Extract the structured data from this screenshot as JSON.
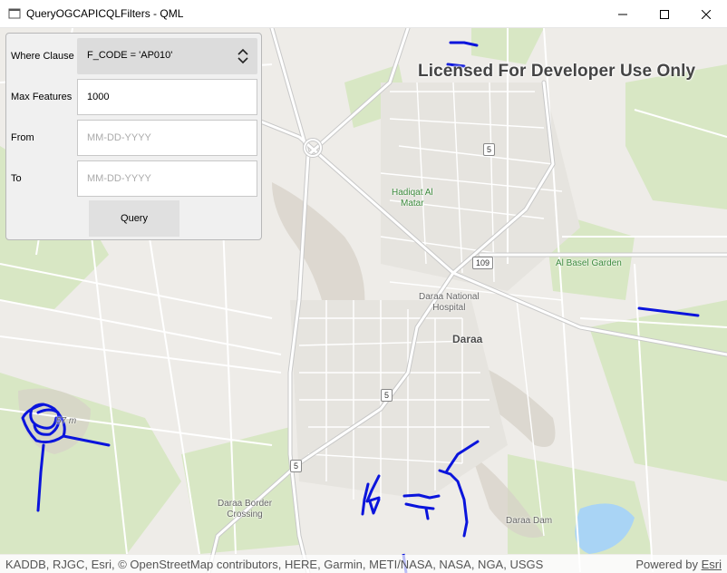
{
  "window": {
    "title": "QueryOGCAPICQLFilters - QML",
    "app_icon": "qt-app-icon",
    "controls": [
      "minimize-icon",
      "maximize-icon",
      "close-icon"
    ]
  },
  "panel": {
    "where_label": "Where Clause",
    "where_value": "F_CODE = 'AP010'",
    "max_label": "Max Features",
    "max_value": "1000",
    "from_label": "From",
    "from_placeholder": "MM-DD-YYYY",
    "to_label": "To",
    "to_placeholder": "MM-DD-YYYY",
    "query_button": "Query"
  },
  "map": {
    "watermark": "Licensed For Developer Use Only",
    "labels": {
      "hadiqat": "Hadiqat Al\nMatar",
      "basel": "Al Basel Garden",
      "hospital": "Daraa National\nHospital",
      "city": "Daraa",
      "border": "Daraa Border\nCrossing",
      "dam": "Daraa Dam",
      "elevation": "57 m"
    },
    "shields": [
      "5",
      "109",
      "5",
      "5"
    ],
    "attribution": "KADDB, RJGC, Esri, © OpenStreetMap contributors, HERE, Garmin, METI/NASA, NASA, NGA, USGS",
    "powered_by": "Powered by",
    "powered_link": "Esri",
    "colors": {
      "feature_line": "#0a14dc",
      "park": "#d8e7c4",
      "water": "#a9d4f5",
      "road": "#ffffff",
      "major_road": "#c8c8c8",
      "background": "#eeece8"
    }
  }
}
